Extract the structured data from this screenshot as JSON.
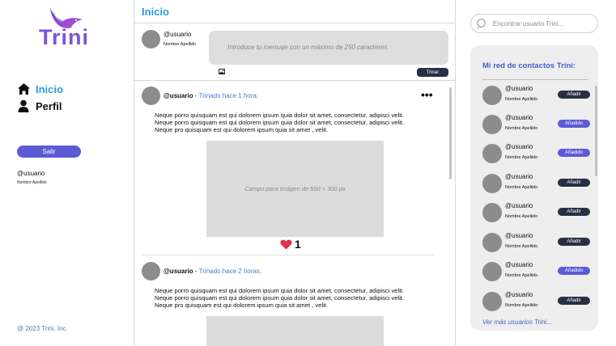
{
  "sidebar": {
    "logo_text": "Trini",
    "nav": [
      {
        "label": "Inicio",
        "icon": "home-icon"
      },
      {
        "label": "Perfil",
        "icon": "user-icon"
      }
    ],
    "logout_label": "Salir",
    "user_handle": "@usuario",
    "user_name": "Nombre Apellido",
    "copyright": "@ 2023 Trini, Inc."
  },
  "feed": {
    "title": "Inicio",
    "compose": {
      "user_handle": "@usuario",
      "user_name": "Nombre Apellido",
      "placeholder": "Introduce tu mensaje con un máximo de 250 caracteres.",
      "submit_label": "Trinar"
    },
    "posts": [
      {
        "user_handle": "@usuario",
        "separator": " - ",
        "time": "Trinado hace 1 hora.",
        "lines": [
          "Neque porro quisquam est qui dolorem ipsum quia dolor sit amet, consectetur, adipisci velit.",
          "Neque porro quisquam est qui dolorem ipsum quia dolor sit amet, consectetur, adipisci velit.",
          "Neque pro quisquam est qui dolorem ipsum quia sit amet , velit."
        ],
        "image_placeholder": "Campo para Imágen de 550 × 300 px",
        "likes": "1"
      },
      {
        "user_handle": "@usuario",
        "separator": " - ",
        "time": "Trinado hace 2 horas.",
        "lines": [
          "Neque porro quisquam est qui dolorem ipsum quia dolor sit amet, consectetur, adipisci velit.",
          "Neque porro quisquam est qui dolorem ipsum quia dolor sit amet, consectetur, adipisci velit.",
          "Neque pro quisquam est qui dolorem ipsum quia sit amet , velit."
        ]
      }
    ]
  },
  "contacts_panel": {
    "search_placeholder": "Encontrar usuario Trini...",
    "title": "Mi red de contactos Trini:",
    "contacts": [
      {
        "user_handle": "@usuario",
        "user_name": "Nombre Apellido",
        "button": "Añadir",
        "state": "add"
      },
      {
        "user_handle": "@usuario",
        "user_name": "Nombre Apellido",
        "button": "Añadido",
        "state": "added"
      },
      {
        "user_handle": "@usuario",
        "user_name": "Nombre Apellido",
        "button": "Añadido",
        "state": "added"
      },
      {
        "user_handle": "@usuario",
        "user_name": "Nombre Apellido",
        "button": "Añadir",
        "state": "add"
      },
      {
        "user_handle": "@usuario",
        "user_name": "Nombre Apellido",
        "button": "Añadir",
        "state": "add"
      },
      {
        "user_handle": "@usuario",
        "user_name": "Nombre Apellido",
        "button": "Añadir",
        "state": "add"
      },
      {
        "user_handle": "@usuario",
        "user_name": "Nombre Apellido",
        "button": "Añadido",
        "state": "added"
      },
      {
        "user_handle": "@usuario",
        "user_name": "Nombre Apellido",
        "button": "Añadir",
        "state": "add"
      }
    ],
    "more_label": "Ver más usuarios Trini..."
  },
  "colors": {
    "accent_blue": "#2e9ad8",
    "button_purple": "#5b5bd6",
    "button_dark": "#263043",
    "like_red": "#e0344a"
  }
}
